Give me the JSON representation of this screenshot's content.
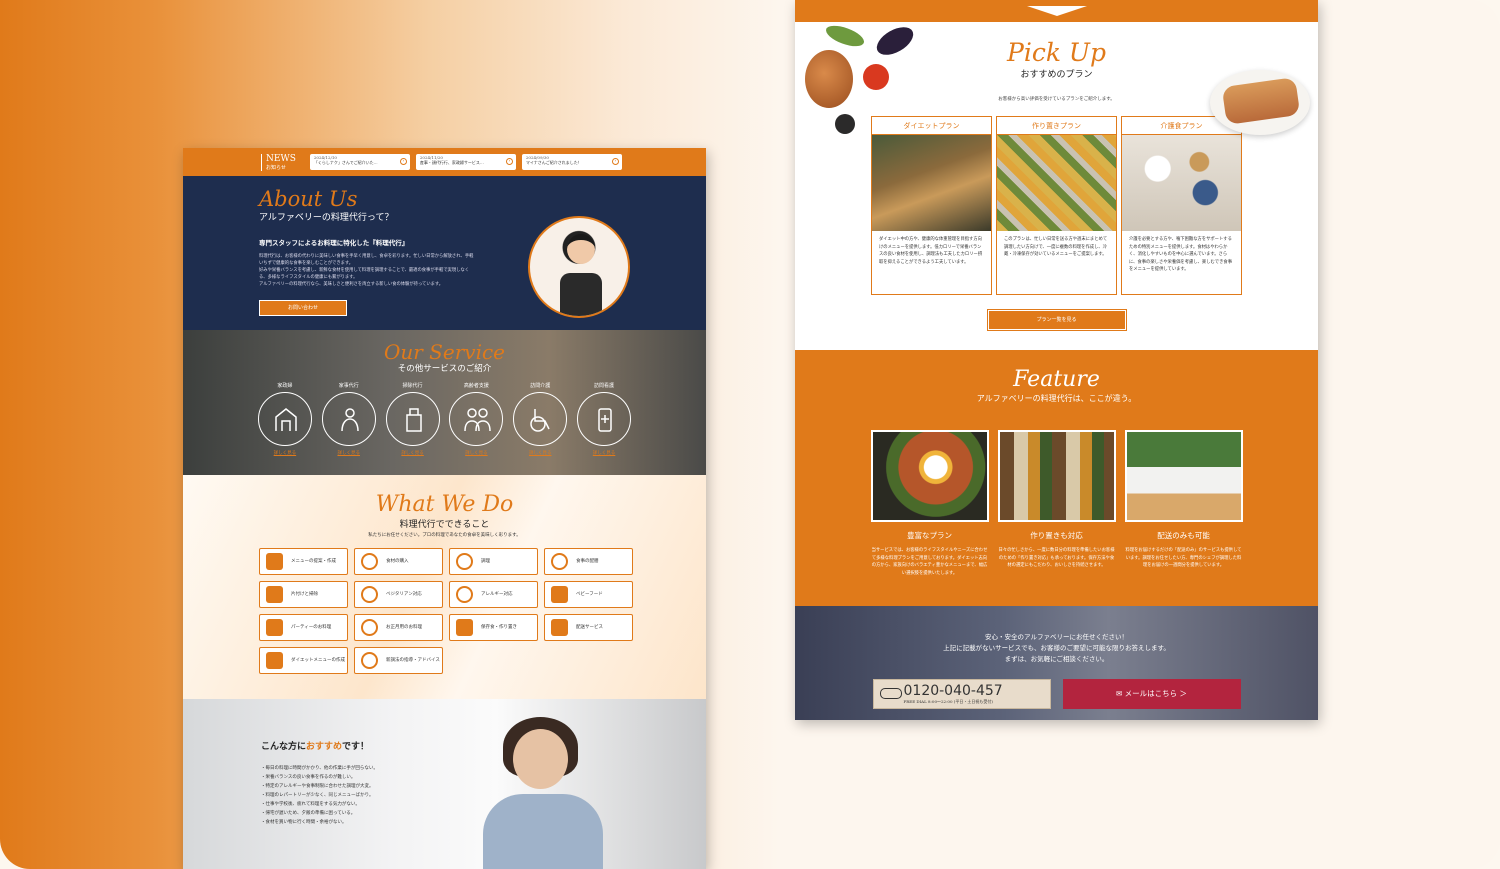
{
  "left": {
    "news": {
      "title": "NEWS",
      "subtitle": "お知らせ",
      "items": [
        {
          "date": "2024/12/10",
          "text": "「くらしナク」さんでご紹介いた…"
        },
        {
          "date": "2024/11/20",
          "text": "産事・顔代行行、家政婦サービス…"
        },
        {
          "date": "2024/09/30",
          "text": "マイナさんご紹介されました！"
        }
      ]
    },
    "about": {
      "title": "About Us",
      "subtitle": "アルファベリーの料理代行って？",
      "lead": "専門スタッフによるお料理に特化した『料理代行』",
      "body": [
        "料理代行は、お客様の代わりに美味しい食事を手早く用意し、食卓を彩ります。忙しい日常から解放され、手軽",
        "いちずで健康的な食事を楽しむことができます。",
        "好みや栄養バランスを考慮し、新鮮な食材を使用して料理を調理することで、最適の食事が手軽で実現しなく",
        "る、多様なライフスタイルの健康にも繋がります。",
        "アルファベリーの料理代行なら、美味しさと便利さを両立する新しい食の体験が待っています。"
      ],
      "button": "お問い合わせ"
    },
    "service": {
      "title": "Our Service",
      "subtitle": "その他サービスのご紹介",
      "items": [
        {
          "label": "家政婦",
          "more": "詳しく見る"
        },
        {
          "label": "家事代行",
          "more": "詳しく見る"
        },
        {
          "label": "掃除代行",
          "more": "詳しく見る"
        },
        {
          "label": "高齢者支援",
          "more": "詳しく見る"
        },
        {
          "label": "訪問介護",
          "more": "詳しく見る"
        },
        {
          "label": "訪問看護",
          "more": "詳しく見る"
        }
      ]
    },
    "wwd": {
      "title": "What We Do",
      "subtitle": "料理代行でできること",
      "desc": "私たちにお任せください。プロの料理であなたの食卓を美味しく彩ります。",
      "items": [
        "メニューの提案・作成",
        "食材の購入",
        "調理",
        "食事の配膳",
        "片付けと掃除",
        "ベジタリアン対応",
        "アレルギー対応",
        "ベビーフード",
        "パーティーのお料理",
        "お正月用のお料理",
        "保存食・作り置き",
        "配送サービス",
        "ダイエットメニューの作成",
        "新調法の指導・アドバイス"
      ]
    },
    "recommend": {
      "title_pre": "こんな方に",
      "title_em": "おすすめ",
      "title_post": "です！",
      "items": [
        "・毎日の料理に時間がかかり、他の作業に手が回らない。",
        "・栄養バランスの良い食事を作るのが難しい。",
        "・特定のアレルギーや食事制限に合わせた調理が大変。",
        "・料理のレパートリーが少なく、同じメニューばかり。",
        "・仕事や学校後、疲れて料理をする気力がない。",
        "・帰宅が遅いため、夕飯の準備に困っている。",
        "・食材を買い物に行く時間・余裕がない。"
      ]
    }
  },
  "right": {
    "pickup": {
      "title": "Pick Up",
      "subtitle": "おすすめのプラン",
      "desc": "お客様から高い評価を受けているプランをご紹介します。",
      "plans": [
        {
          "title": "ダイエットプラン",
          "desc": "ダイエット中の方や、健康的な体重管理を目指す方向けのメニューを提供します。低カロリーで栄養バランスの良い食材を使用し、調理法も工夫したカロリー摂取を抑えることができるよう工夫しています。"
        },
        {
          "title": "作り置きプラン",
          "desc": "このプランは、忙しい日常を送る方や週末にまとめて調理したい方向けで、一度に複数の料理を作成し、冷蔵・冷凍保存が効いているメニューをご提案します。"
        },
        {
          "title": "介護食プラン",
          "desc": "介護を必要とする方や、噛下困難な方をサポートするための特別メニューを提供します。食材はやわらかく、消化しやすいものを中心に選んでいます。さらに、食事の楽しさや栄養価を考慮し、楽しむでき食事をメニューを提供しています。"
        }
      ],
      "button": "プラン一覧を見る"
    },
    "feature": {
      "title": "Feature",
      "subtitle": "アルファベリーの料理代行は、ここが違う。",
      "items": [
        {
          "title": "豊富なプラン",
          "desc": "当サービスでは、お客様のライフスタイルやニーズに合わせて多様な料理プランをご用意しております。ダイエット志向の方から、家族向けのバラエティ豊かなメニューまで、幅広い選択肢を提供いたします。"
        },
        {
          "title": "作り置きも対応",
          "desc": "日々の忙しさから、一度に数日分の料理を準備したいお客様のための「作り置き対応」も承っております。保存方法や食材の選定にもこだわり、おいしさを持続させます。"
        },
        {
          "title": "配送のみも可能",
          "desc": "料理をお届けするだけの「配送のみ」のサービスも提供しています。調理をお任せしたい方、専門のシェフが調理した料理をお届けの一週間分を提供しています。"
        }
      ]
    },
    "contact": {
      "lines": [
        "安心・安全のアルファベリーにお任せください！",
        "上記に記載がないサービスでも、お客様のご要望に可能な限りお答えします。",
        "まずは、お気軽にご相談ください。"
      ],
      "tel": "0120-040-457",
      "hours": "FREE DIAL 8:00〜22:00 (平日・土日祝も受付)",
      "mail": "メールはこちら ＞"
    }
  },
  "colors": {
    "accent": "#e07a1a",
    "navy": "#1e2d4e",
    "mail": "#b3243e"
  }
}
